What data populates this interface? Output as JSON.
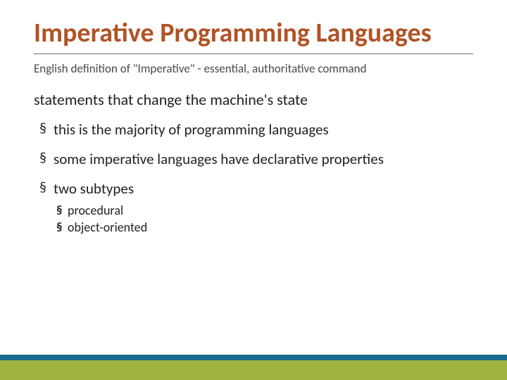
{
  "title": "Imperative Programming Languages",
  "subtitle": "English definition of \"Imperative\" - essential, authoritative command",
  "lead": "statements that change the machine's state",
  "bullets": [
    {
      "text": "this is the majority of programming languages"
    },
    {
      "text": "some imperative languages have declarative properties"
    },
    {
      "text": "two subtypes",
      "sub": [
        {
          "text": "procedural"
        },
        {
          "text": "object-oriented"
        }
      ]
    }
  ],
  "colors": {
    "title": "#b15326",
    "footer_top": "#1a6a8e",
    "footer_bottom": "#9fb241"
  }
}
